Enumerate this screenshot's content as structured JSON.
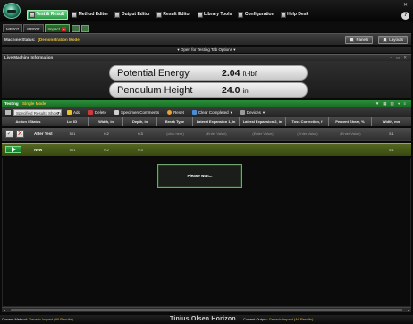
{
  "window": {
    "minimize": "–",
    "close": "✕",
    "help": "?"
  },
  "menu": [
    {
      "label": "Test & Result",
      "active": true
    },
    {
      "label": "Method Editor",
      "active": false
    },
    {
      "label": "Output Editor",
      "active": false
    },
    {
      "label": "Result Editor",
      "active": false
    },
    {
      "label": "Library Tools",
      "active": false
    },
    {
      "label": "Configuration",
      "active": false
    },
    {
      "label": "Help Desk",
      "active": false
    }
  ],
  "tabs": [
    {
      "label": "MP007"
    },
    {
      "label": "MP007"
    },
    {
      "label": "Impact"
    }
  ],
  "tab_close": "x",
  "machine_status": {
    "label": "Machine Status:",
    "value": "(Demonstration Mode)"
  },
  "panel_buttons": {
    "panels": "Panels",
    "layouts": "Layouts"
  },
  "testing_tab_options": "▾  Open for Testing Tab Options  ▾",
  "live_info": {
    "header": "Live Machine Information",
    "readouts": [
      {
        "label": "Potential Energy",
        "value": "2.04",
        "unit": "ft·lbf"
      },
      {
        "label": "Pendulum Height",
        "value": "24.0",
        "unit": "in"
      }
    ]
  },
  "testing": {
    "label": "Testing",
    "value": "Single Mode"
  },
  "toolbar": {
    "select": "Specified Results Shown",
    "add": "Add",
    "delete": "Delete",
    "specimen_comments": "Specimen Comments",
    "reset": "Reset",
    "clear_completed": "Clear Completed",
    "devices": "Devices"
  },
  "table": {
    "columns": [
      "Action / Status",
      "Lot ID",
      "Width, in",
      "Depth, in",
      "Break Type",
      "Lateral Expansion 1, in",
      "Lateral Expansion 2, in",
      "Toss Correction, f",
      "Percent Shear, %",
      "Width, mm"
    ],
    "rows": [
      {
        "label": "After Test",
        "cells": [
          "501",
          "0.2",
          "0.3",
          "(click here)",
          "(Enter Value)",
          "(Enter Value)",
          "(Enter Value)",
          "(Enter Value)",
          "5.1"
        ]
      },
      {
        "label": "New",
        "cells": [
          "501",
          "0.2",
          "0.3",
          "",
          "",
          "",
          "",
          "",
          "5.1"
        ]
      }
    ]
  },
  "dialog": {
    "message": "Please wait..."
  },
  "footer": {
    "method_label": "Current Method:",
    "method_value": "Generic Impact (All Results)",
    "brand": "Tinius Olsen Horizon",
    "output_label": "Current Output:",
    "output_value": "Generic Impact (All Results)"
  }
}
